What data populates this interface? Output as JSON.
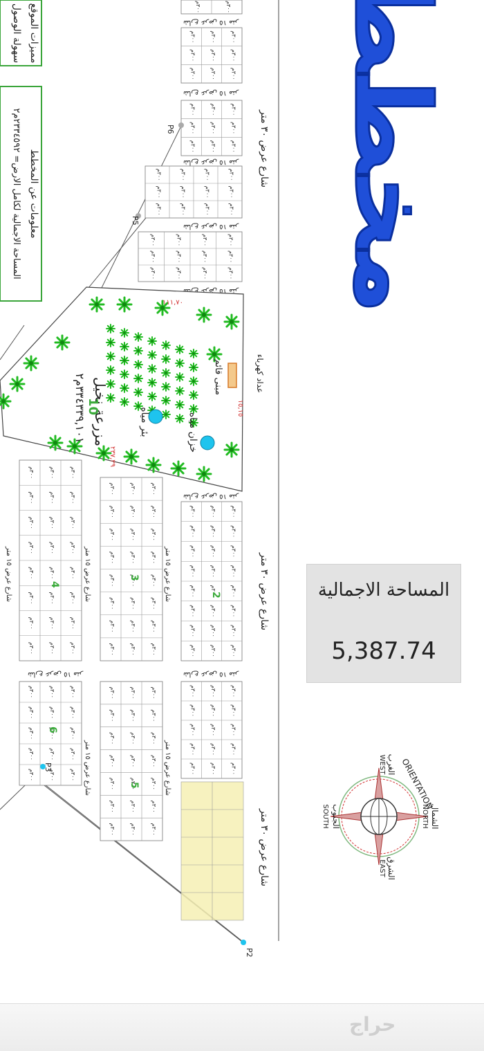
{
  "brand_title": "مخطط",
  "area_card": {
    "title": "المساحة الاجمالية",
    "value": "5,387.74"
  },
  "info_boxes": {
    "site_features": "مميزات الموقع",
    "site_access": "سهولة الوصول",
    "plan_info": "معلومات عن المخطط",
    "total_area_text": "المساحة الاجمالية لكامل الارض= ٢٣٣٤٥٩٢م٢"
  },
  "streets": {
    "main_30m": "شارع عرض ٣٠ متر",
    "w15": "شارع عرض ١٥ متر",
    "generic": "شارع"
  },
  "farm": {
    "label": "مزرعة نخيل",
    "number": "10",
    "area": "٣٣٤٣٣٩,١٠١م٢",
    "well_label": "بئر مياه",
    "tank_label": "خزان مياه",
    "building_label": "مبنى قائم",
    "meter_label": "عداد كهرباء",
    "edge_top": "١١١,٧٠",
    "edge_bottom": "٢٣٧,٣٩",
    "edge_right": "١٥,١٥"
  },
  "points": [
    "P2",
    "P3",
    "P5",
    "P6"
  ],
  "compass": {
    "orientation": "ORIENTATION",
    "north_ar": "الشمال",
    "north": "NORTH",
    "south_ar": "الجنوب",
    "south": "SOUTH",
    "east_ar": "الشرق",
    "east": "EAST",
    "west_ar": "الغرب",
    "west": "WEST"
  },
  "plot_area_label": "٣٠٠م",
  "watermark": "حراج",
  "colors": {
    "brand_blue": "#1f4fd8",
    "plot_highlight": "#f6f0b4",
    "palm_green": "#22bb22",
    "water_blue": "#1ec4ee",
    "dimension_red": "#d23232",
    "block_number_green": "#3aaa3a",
    "info_border_green": "#3aa53a"
  }
}
